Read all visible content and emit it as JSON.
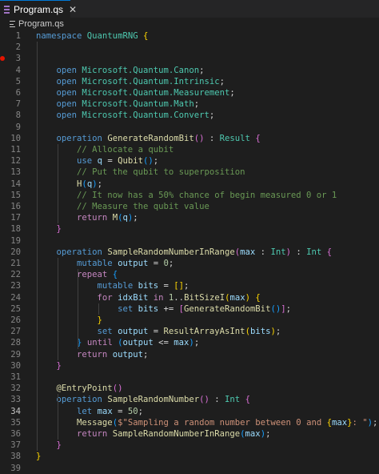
{
  "tab": {
    "label": "Program.qs",
    "close": "✕"
  },
  "breadcrumb": {
    "file": "Program.qs"
  },
  "editor": {
    "current_line": 34,
    "breakpoint_line": 3,
    "lines": [
      [
        [
          "kw",
          "namespace"
        ],
        [
          "pn",
          " "
        ],
        [
          "ns",
          "QuantumRNG"
        ],
        [
          "pn",
          " "
        ],
        [
          "b1",
          "{"
        ]
      ],
      [],
      [],
      [
        [
          "pn",
          "    "
        ],
        [
          "kw",
          "open"
        ],
        [
          "pn",
          " "
        ],
        [
          "ns",
          "Microsoft.Quantum.Canon"
        ],
        [
          "pn",
          ";"
        ]
      ],
      [
        [
          "pn",
          "    "
        ],
        [
          "kw",
          "open"
        ],
        [
          "pn",
          " "
        ],
        [
          "ns",
          "Microsoft.Quantum.Intrinsic"
        ],
        [
          "pn",
          ";"
        ]
      ],
      [
        [
          "pn",
          "    "
        ],
        [
          "kw",
          "open"
        ],
        [
          "pn",
          " "
        ],
        [
          "ns",
          "Microsoft.Quantum.Measurement"
        ],
        [
          "pn",
          ";"
        ]
      ],
      [
        [
          "pn",
          "    "
        ],
        [
          "kw",
          "open"
        ],
        [
          "pn",
          " "
        ],
        [
          "ns",
          "Microsoft.Quantum.Math"
        ],
        [
          "pn",
          ";"
        ]
      ],
      [
        [
          "pn",
          "    "
        ],
        [
          "kw",
          "open"
        ],
        [
          "pn",
          " "
        ],
        [
          "ns",
          "Microsoft.Quantum.Convert"
        ],
        [
          "pn",
          ";"
        ]
      ],
      [],
      [
        [
          "pn",
          "    "
        ],
        [
          "kw",
          "operation"
        ],
        [
          "pn",
          " "
        ],
        [
          "fn",
          "GenerateRandomBit"
        ],
        [
          "b2",
          "()"
        ],
        [
          "pn",
          " : "
        ],
        [
          "type",
          "Result"
        ],
        [
          "pn",
          " "
        ],
        [
          "b2",
          "{"
        ]
      ],
      [
        [
          "pn",
          "        "
        ],
        [
          "cm",
          "// Allocate a qubit"
        ]
      ],
      [
        [
          "pn",
          "        "
        ],
        [
          "kw",
          "use"
        ],
        [
          "pn",
          " "
        ],
        [
          "var",
          "q"
        ],
        [
          "pn",
          " = "
        ],
        [
          "fn",
          "Qubit"
        ],
        [
          "b3",
          "()"
        ],
        [
          "pn",
          ";"
        ]
      ],
      [
        [
          "pn",
          "        "
        ],
        [
          "cm",
          "// Put the qubit to superposition"
        ]
      ],
      [
        [
          "pn",
          "        "
        ],
        [
          "fn",
          "H"
        ],
        [
          "b3",
          "("
        ],
        [
          "var",
          "q"
        ],
        [
          "b3",
          ")"
        ],
        [
          "pn",
          ";"
        ]
      ],
      [
        [
          "pn",
          "        "
        ],
        [
          "cm",
          "// It now has a 50% chance of begin measured 0 or 1"
        ]
      ],
      [
        [
          "pn",
          "        "
        ],
        [
          "cm",
          "// Measure the qubit value"
        ]
      ],
      [
        [
          "pn",
          "        "
        ],
        [
          "ctrl",
          "return"
        ],
        [
          "pn",
          " "
        ],
        [
          "fn",
          "M"
        ],
        [
          "b3",
          "("
        ],
        [
          "var",
          "q"
        ],
        [
          "b3",
          ")"
        ],
        [
          "pn",
          ";"
        ]
      ],
      [
        [
          "pn",
          "    "
        ],
        [
          "b2",
          "}"
        ]
      ],
      [],
      [
        [
          "pn",
          "    "
        ],
        [
          "kw",
          "operation"
        ],
        [
          "pn",
          " "
        ],
        [
          "fn",
          "SampleRandomNumberInRange"
        ],
        [
          "b2",
          "("
        ],
        [
          "var",
          "max"
        ],
        [
          "pn",
          " : "
        ],
        [
          "type",
          "Int"
        ],
        [
          "b2",
          ")"
        ],
        [
          "pn",
          " : "
        ],
        [
          "type",
          "Int"
        ],
        [
          "pn",
          " "
        ],
        [
          "b2",
          "{"
        ]
      ],
      [
        [
          "pn",
          "        "
        ],
        [
          "kw",
          "mutable"
        ],
        [
          "pn",
          " "
        ],
        [
          "var",
          "output"
        ],
        [
          "pn",
          " = "
        ],
        [
          "num",
          "0"
        ],
        [
          "pn",
          ";"
        ]
      ],
      [
        [
          "pn",
          "        "
        ],
        [
          "ctrl",
          "repeat"
        ],
        [
          "pn",
          " "
        ],
        [
          "b3",
          "{"
        ]
      ],
      [
        [
          "pn",
          "            "
        ],
        [
          "kw",
          "mutable"
        ],
        [
          "pn",
          " "
        ],
        [
          "var",
          "bits"
        ],
        [
          "pn",
          " = "
        ],
        [
          "b1",
          "[]"
        ],
        [
          "pn",
          ";"
        ]
      ],
      [
        [
          "pn",
          "            "
        ],
        [
          "ctrl",
          "for"
        ],
        [
          "pn",
          " "
        ],
        [
          "var",
          "idxBit"
        ],
        [
          "pn",
          " "
        ],
        [
          "ctrl",
          "in"
        ],
        [
          "pn",
          " "
        ],
        [
          "num",
          "1"
        ],
        [
          "pn",
          ".."
        ],
        [
          "fn",
          "BitSizeI"
        ],
        [
          "b1",
          "("
        ],
        [
          "var",
          "max"
        ],
        [
          "b1",
          ")"
        ],
        [
          "pn",
          " "
        ],
        [
          "b1",
          "{"
        ]
      ],
      [
        [
          "pn",
          "                "
        ],
        [
          "kw",
          "set"
        ],
        [
          "pn",
          " "
        ],
        [
          "var",
          "bits"
        ],
        [
          "pn",
          " += "
        ],
        [
          "b2",
          "["
        ],
        [
          "fn",
          "GenerateRandomBit"
        ],
        [
          "b3",
          "()"
        ],
        [
          "b2",
          "]"
        ],
        [
          "pn",
          ";"
        ]
      ],
      [
        [
          "pn",
          "            "
        ],
        [
          "b1",
          "}"
        ]
      ],
      [
        [
          "pn",
          "            "
        ],
        [
          "kw",
          "set"
        ],
        [
          "pn",
          " "
        ],
        [
          "var",
          "output"
        ],
        [
          "pn",
          " = "
        ],
        [
          "fn",
          "ResultArrayAsInt"
        ],
        [
          "b1",
          "("
        ],
        [
          "var",
          "bits"
        ],
        [
          "b1",
          ")"
        ],
        [
          "pn",
          ";"
        ]
      ],
      [
        [
          "pn",
          "        "
        ],
        [
          "b3",
          "}"
        ],
        [
          "pn",
          " "
        ],
        [
          "ctrl",
          "until"
        ],
        [
          "pn",
          " "
        ],
        [
          "b3",
          "("
        ],
        [
          "var",
          "output"
        ],
        [
          "pn",
          " <= "
        ],
        [
          "var",
          "max"
        ],
        [
          "b3",
          ")"
        ],
        [
          "pn",
          ";"
        ]
      ],
      [
        [
          "pn",
          "        "
        ],
        [
          "ctrl",
          "return"
        ],
        [
          "pn",
          " "
        ],
        [
          "var",
          "output"
        ],
        [
          "pn",
          ";"
        ]
      ],
      [
        [
          "pn",
          "    "
        ],
        [
          "b2",
          "}"
        ]
      ],
      [],
      [
        [
          "pn",
          "    "
        ],
        [
          "fn",
          "@EntryPoint"
        ],
        [
          "b2",
          "()"
        ]
      ],
      [
        [
          "pn",
          "    "
        ],
        [
          "kw",
          "operation"
        ],
        [
          "pn",
          " "
        ],
        [
          "fn",
          "SampleRandomNumber"
        ],
        [
          "b2",
          "()"
        ],
        [
          "pn",
          " : "
        ],
        [
          "type",
          "Int"
        ],
        [
          "pn",
          " "
        ],
        [
          "b2",
          "{"
        ]
      ],
      [
        [
          "pn",
          "        "
        ],
        [
          "kw",
          "let"
        ],
        [
          "pn",
          " "
        ],
        [
          "var",
          "max"
        ],
        [
          "pn",
          " = "
        ],
        [
          "num",
          "50"
        ],
        [
          "pn",
          ";"
        ]
      ],
      [
        [
          "pn",
          "        "
        ],
        [
          "fn",
          "Message"
        ],
        [
          "b3",
          "("
        ],
        [
          "str",
          "$\"Sampling a random number between 0 and "
        ],
        [
          "b1",
          "{"
        ],
        [
          "var",
          "max"
        ],
        [
          "b1",
          "}"
        ],
        [
          "str",
          ": \""
        ],
        [
          "b3",
          ")"
        ],
        [
          "pn",
          ";"
        ]
      ],
      [
        [
          "pn",
          "        "
        ],
        [
          "ctrl",
          "return"
        ],
        [
          "pn",
          " "
        ],
        [
          "fn",
          "SampleRandomNumberInRange"
        ],
        [
          "b3",
          "("
        ],
        [
          "var",
          "max"
        ],
        [
          "b3",
          ")"
        ],
        [
          "pn",
          ";"
        ]
      ],
      [
        [
          "pn",
          "    "
        ],
        [
          "b2",
          "}"
        ]
      ],
      [
        [
          "b1",
          "}"
        ]
      ],
      []
    ]
  }
}
